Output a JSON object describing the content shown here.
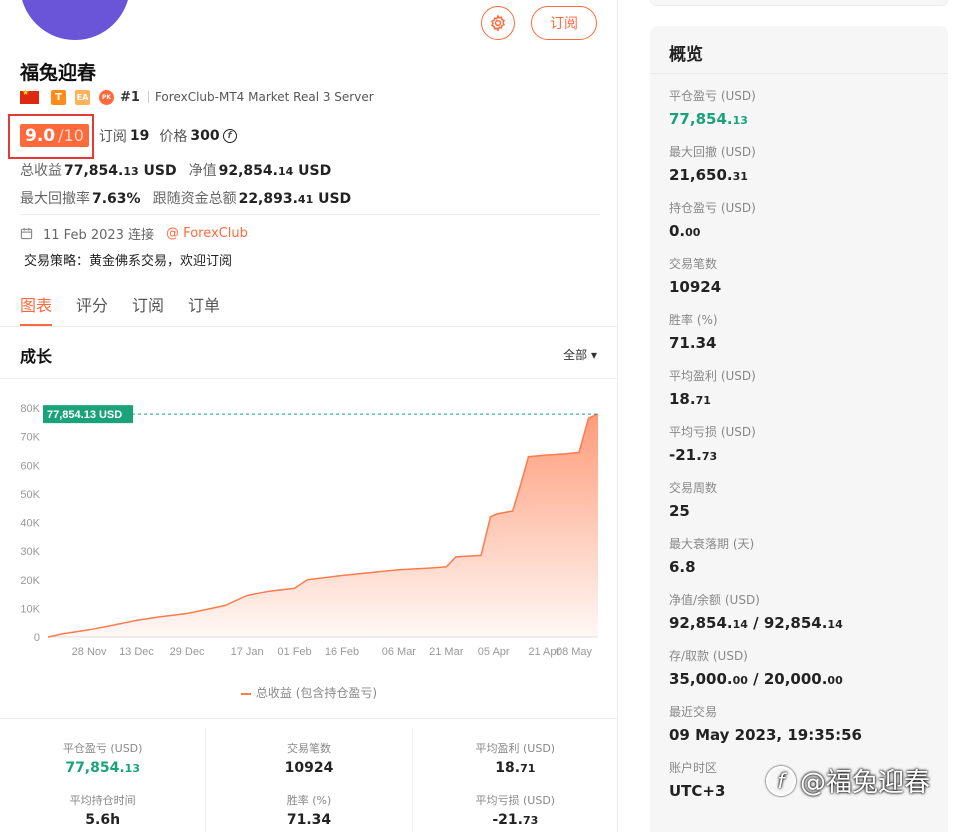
{
  "header": {
    "gear_label": "",
    "subscribe_label": "订阅",
    "title": "福兔迎春"
  },
  "badges": {
    "t": "T",
    "ea": "EA",
    "pk": "PK",
    "rank": "#1",
    "server": "ForexClub-MT4 Market Real 3 Server"
  },
  "score": {
    "value": "9.0",
    "max": "/10",
    "subs_label": "订阅",
    "subs_value": "19",
    "price_label": "价格",
    "price_value": "300",
    "price_icon": "coin-icon"
  },
  "stats": {
    "profit_label": "总收益",
    "profit_main": "77,854.",
    "profit_dec": "13",
    "profit_unit": " USD",
    "equity_label": "净值",
    "equity_main": "92,854.",
    "equity_dec": "14",
    "equity_unit": " USD",
    "dd_label": "最大回撤率",
    "dd_value": "7.63%",
    "follow_label": "跟随资金总额",
    "follow_main": "22,893.",
    "follow_dec": "41",
    "follow_unit": " USD"
  },
  "since": {
    "date_text": "11 Feb 2023 连接",
    "broker": "@ ForexClub"
  },
  "strategy": "交易策略：黄金佛系交易，欢迎订阅",
  "tabs": [
    "图表",
    "评分",
    "订阅",
    "订单"
  ],
  "growth": {
    "title": "成长",
    "filter": "全部 ▾",
    "legend": "总收益 (包含持仓盈亏)"
  },
  "chart_data": {
    "type": "area",
    "title": "",
    "xlabel": "",
    "ylabel": "",
    "ylim": [
      0,
      80000
    ],
    "yticks": [
      "0",
      "10K",
      "20K",
      "30K",
      "40K",
      "50K",
      "60K",
      "70K",
      "80K"
    ],
    "xticks": [
      "28 Nov",
      "13 Dec",
      "29 Dec",
      "17 Jan",
      "01 Feb",
      "16 Feb",
      "06 Mar",
      "21 Mar",
      "05 Apr",
      "21 Apr",
      "08 May"
    ],
    "last_value_label": "77,854.13 USD",
    "color": "#ff7a4d",
    "series": [
      {
        "name": "总收益 (包含持仓盈亏)",
        "x": [
          "2022-11-15",
          "2022-11-20",
          "2022-11-28",
          "2022-12-05",
          "2022-12-13",
          "2022-12-20",
          "2022-12-29",
          "2023-01-05",
          "2023-01-10",
          "2023-01-17",
          "2023-01-24",
          "2023-02-01",
          "2023-02-05",
          "2023-02-16",
          "2023-02-25",
          "2023-03-06",
          "2023-03-15",
          "2023-03-21",
          "2023-03-24",
          "2023-04-01",
          "2023-04-04",
          "2023-04-06",
          "2023-04-11",
          "2023-04-14",
          "2023-04-16",
          "2023-04-21",
          "2023-04-28",
          "2023-05-02",
          "2023-05-05",
          "2023-05-08"
        ],
        "values": [
          0,
          1200,
          2500,
          4000,
          5800,
          7000,
          8200,
          9800,
          11000,
          14500,
          16000,
          17000,
          20000,
          21500,
          22500,
          23500,
          24000,
          24500,
          28000,
          28500,
          42000,
          43000,
          44000,
          55000,
          63000,
          63500,
          64000,
          64500,
          76500,
          77854.13
        ]
      }
    ]
  },
  "bottom_stats": [
    [
      {
        "label": "平仓盈亏 (USD)",
        "main": "77,854.",
        "dec": "13",
        "green": true
      },
      {
        "label": "平均持仓时间",
        "main": "5.6h",
        "dec": "",
        "green": false
      }
    ],
    [
      {
        "label": "交易笔数",
        "main": "10924",
        "dec": "",
        "green": false
      },
      {
        "label": "胜率 (%)",
        "main": "71.34",
        "dec": "",
        "green": false
      }
    ],
    [
      {
        "label": "平均盈利 (USD)",
        "main": "18.",
        "dec": "71",
        "green": false
      },
      {
        "label": "平均亏损 (USD)",
        "main": "-21.",
        "dec": "73",
        "green": false
      }
    ]
  ],
  "overview": {
    "title": "概览",
    "items": [
      {
        "label": "平仓盈亏 (USD)",
        "main": "77,854.",
        "dec": "13",
        "green": true
      },
      {
        "label": "最大回撤 (USD)",
        "main": "21,650.",
        "dec": "31",
        "green": false
      },
      {
        "label": "持仓盈亏 (USD)",
        "main": "0.",
        "dec": "00",
        "green": false
      },
      {
        "label": "交易笔数",
        "main": "10924",
        "dec": "",
        "green": false
      },
      {
        "label": "胜率 (%)",
        "main": "71.34",
        "dec": "",
        "green": false
      },
      {
        "label": "平均盈利 (USD)",
        "main": "18.",
        "dec": "71",
        "green": false
      },
      {
        "label": "平均亏损 (USD)",
        "main": "-21.",
        "dec": "73",
        "green": false
      },
      {
        "label": "交易周数",
        "main": "25",
        "dec": "",
        "green": false
      },
      {
        "label": "最大衰落期 (天)",
        "main": "6.8",
        "dec": "",
        "green": false
      },
      {
        "label": "净值/余额 (USD)",
        "main": "92,854.",
        "dec": "14",
        "tail": " / 92,854.",
        "tail_dec": "14",
        "green": false
      },
      {
        "label": "存/取款 (USD)",
        "main": "35,000.",
        "dec": "00",
        "tail": " / 20,000.",
        "tail_dec": "00",
        "green": false
      },
      {
        "label": "最近交易",
        "main": "09 May 2023, 19:35:56",
        "dec": "",
        "green": false
      },
      {
        "label": "账户时区",
        "main": "UTC+3",
        "dec": "",
        "green": false
      }
    ]
  },
  "watermark": "@福兔迎春"
}
